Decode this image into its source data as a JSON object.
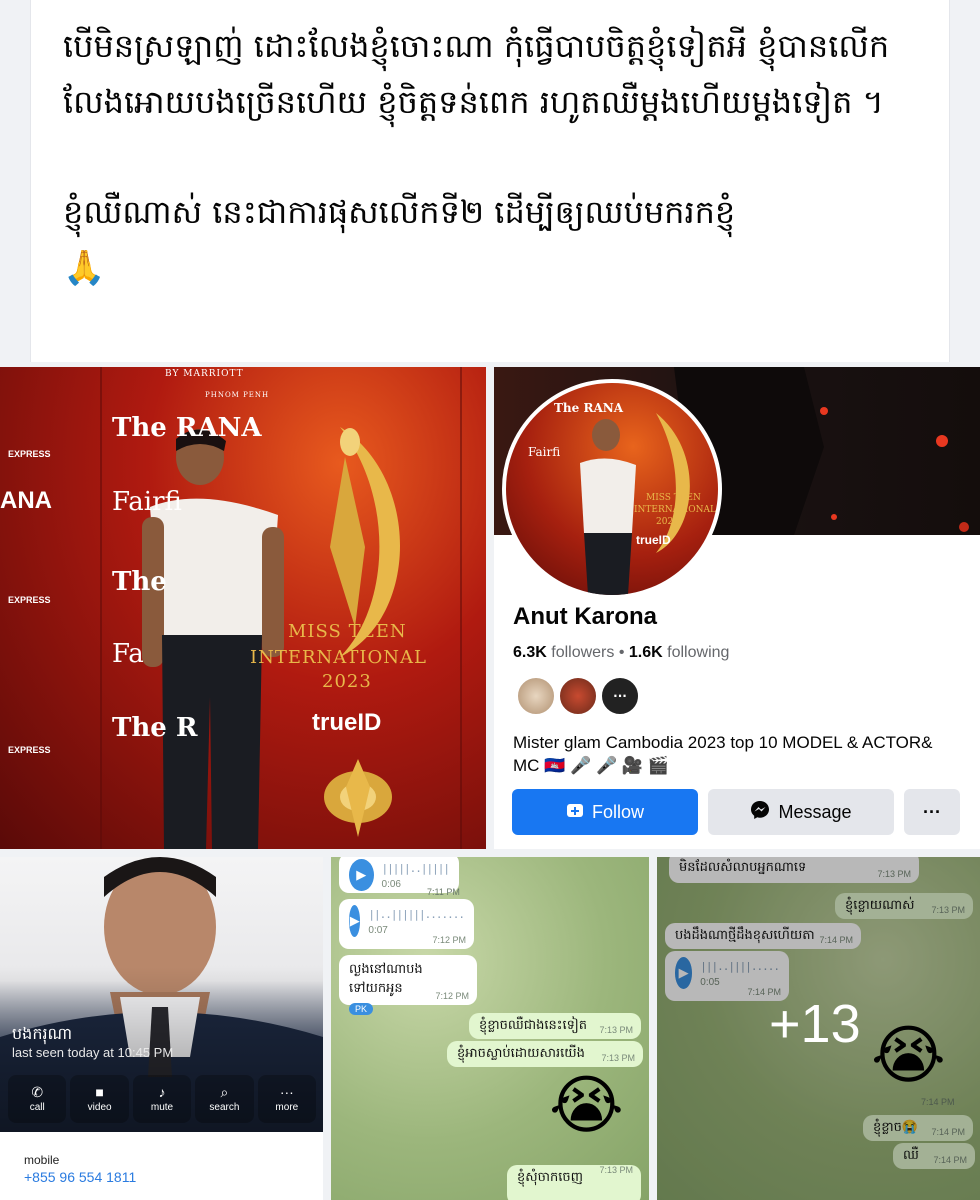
{
  "post": {
    "line1": "បើមិនស្រឡាញ់ ដោះលែងខ្ញុំចោះណា កុំធ្វើបាបចិត្តខ្ញុំទៀតអី ខ្ញុំបានលើកលែងអោយបងច្រើនហើយ ខ្ញុំចិត្តទន់ពេក រហូតឈឺម្តងហើយម្តងទៀត ។",
    "line2": "ខ្ញុំឈឺណាស់  នេះជាការផុសលើកទី២ ដើម្បីឲ្យឈប់មករកខ្ញុំ",
    "emoji": "🙏"
  },
  "event_photo": {
    "by_marriott": "BY MARRIOTT",
    "phnom_penh": "PHNOM PENH",
    "the_rana": "The RANA",
    "fairfield": "Fairfi",
    "ana": "ANA",
    "the": "The",
    "fa": "Fa",
    "the_r": "The R",
    "express": "EXPRESS",
    "miss_teen": "MISS TEEN",
    "international": "INTERNATIONAL",
    "year": "2023",
    "trueid": "trueID"
  },
  "profile": {
    "name": "Anut Karona",
    "followers_count": "6.3K",
    "followers_label": "followers",
    "separator": "•",
    "following_count": "1.6K",
    "following_label": "following",
    "bio": "Mister glam Cambodia 2023 top 10 MODEL & ACTOR& MC 🇰🇭 🎤 🎤 🎥 🎬",
    "follow_label": "Follow",
    "message_label": "Message",
    "more_label": "···",
    "avatar_text_1": "MISS TEEN",
    "avatar_text_2": "INTERNATIONAL",
    "avatar_text_3": "2023",
    "avatar_the_rana": "The RANA",
    "avatar_fairfield": "Fairfi",
    "avatar_trueid": "trueID"
  },
  "contact_card": {
    "name": "បងករុណា",
    "last_seen": "last seen today at 10:45 PM",
    "actions": [
      "call",
      "video",
      "mute",
      "search",
      "more"
    ],
    "mobile_label": "mobile",
    "mobile_number": "+855 96 554 1811"
  },
  "chat1": {
    "voice1": {
      "duration": "0:06",
      "time": "7:11 PM"
    },
    "voice2": {
      "duration": "0:07",
      "time": "7:12 PM"
    },
    "msg1": {
      "text": "ល្ងងនៅណាបងទៅយកអូន",
      "time": "7:12 PM",
      "reaction": "PK"
    },
    "msg2": {
      "text": "ខ្ញុំខ្លាចឈឺជាងនេះទៀត",
      "time": "7:13 PM"
    },
    "msg3": {
      "text": "ខ្ញុំអាចស្លាប់ដោយសារយើង",
      "time": "7:13 PM"
    },
    "msg4": {
      "text": "ខ្ញុំសុំចាកចេញ",
      "time": "7:13 PM"
    }
  },
  "chat2": {
    "msg0": {
      "text": "មិនដែលសំលាបអ្នកណាទេ",
      "time": "7:13 PM"
    },
    "msg1": {
      "text": "ខ្ញុំខ្លោយណាស់",
      "time": "7:13 PM"
    },
    "msg2": {
      "text": "បងដឹងណាថ្មីដឹងខុសហើយតា",
      "time": "7:14 PM"
    },
    "voice1": {
      "duration": "0:05",
      "time": "7:14 PM"
    },
    "time_top": "7:14 PM",
    "msg3": {
      "text": "ខ្ញុំខ្លាច😭",
      "time": "7:14 PM"
    },
    "msg4": {
      "text": "ឈឺ",
      "time": "7:14 PM"
    },
    "more_count": "+13"
  },
  "colors": {
    "facebook_blue": "#1877f2",
    "button_gray": "#e4e6eb",
    "chat_green": "#e2f6cf",
    "event_red": "#b01a10",
    "gold": "#e8b84a"
  },
  "icons": {
    "pray": "folded-hands",
    "follow": "user-add-icon",
    "message": "messenger-icon",
    "play": "play-icon",
    "cry": "loudly-crying-face"
  }
}
